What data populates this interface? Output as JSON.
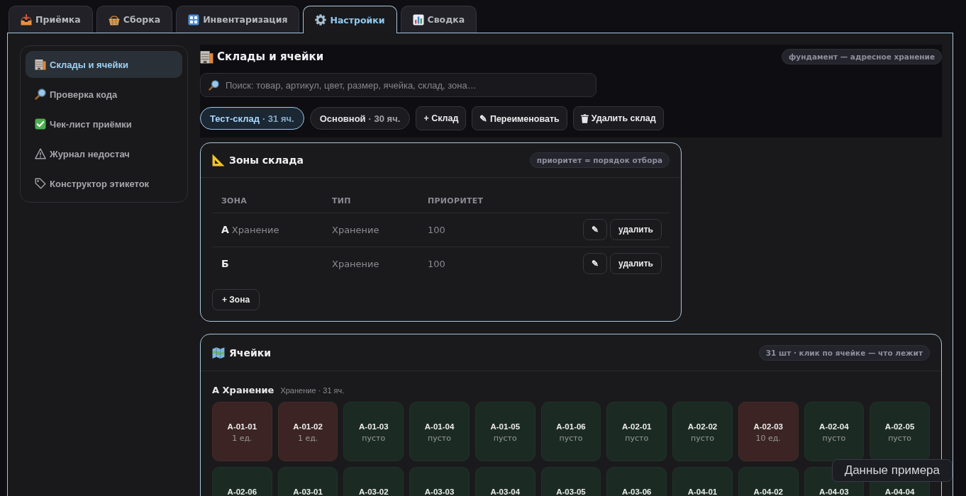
{
  "tabs": [
    {
      "label": "Приёмка",
      "selected": false
    },
    {
      "label": "Сборка",
      "selected": false
    },
    {
      "label": "Инвентаризация",
      "selected": false
    },
    {
      "label": "Настройки",
      "selected": true
    },
    {
      "label": "Сводка",
      "selected": false
    }
  ],
  "sidebar": {
    "items": [
      {
        "label": "Склады и ячейки",
        "selected": true
      },
      {
        "label": "Проверка кода",
        "selected": false
      },
      {
        "label": "Чек-лист приёмки",
        "selected": false
      },
      {
        "label": "Журнал недостач",
        "selected": false
      },
      {
        "label": "Конструктор этикеток",
        "selected": false
      }
    ]
  },
  "warehouse_panel": {
    "title": "Склады и ячейки",
    "badge": "фундамент — адресное хранение",
    "search": {
      "placeholder": "Поиск: товар, артикул, цвет, размер, ячейка, склад, зона…"
    },
    "warehouses": [
      {
        "name": "Тест-склад",
        "meta": "· 31 яч.",
        "selected": true
      },
      {
        "name": "Основной",
        "meta": "· 30 яч.",
        "selected": false
      }
    ],
    "actions": [
      {
        "label": "+ Склад",
        "kind": "text"
      },
      {
        "label": "✎ Переименовать",
        "kind": "text"
      },
      {
        "label": "Удалить склад",
        "kind": "trash"
      }
    ]
  },
  "zones": {
    "title": "Зоны склада",
    "badge": "приоритет = порядок отбора",
    "columns": [
      "ЗОНА",
      "ТИП",
      "ПРИОРИТЕТ"
    ],
    "rows": [
      {
        "zone": "А",
        "zone_note": "Хранение",
        "type": "Хранение",
        "priority": "100",
        "edit_button": "✎",
        "delete_button": "удалить"
      },
      {
        "zone": "Б",
        "type": "Хранение",
        "priority": "100",
        "edit_button": "✎",
        "delete_button": "удалить"
      }
    ],
    "add_button": "+ Зона"
  },
  "cells": {
    "title": "Ячейки",
    "badge": "31 шт · клик по ячейке — что лежит",
    "groups": [
      {
        "name": "А Хранение",
        "meta": "Хранение · 31 яч.",
        "cells": [
          {
            "code": "А-01-01",
            "contents": "1 ед.",
            "occupied": true
          },
          {
            "code": "А-01-02",
            "contents": "1 ед.",
            "occupied": true
          },
          {
            "code": "А-01-03",
            "contents": "пусто",
            "occupied": false
          },
          {
            "code": "А-01-04",
            "contents": "пусто",
            "occupied": false
          },
          {
            "code": "А-01-05",
            "contents": "пусто",
            "occupied": false
          },
          {
            "code": "А-01-06",
            "contents": "пусто",
            "occupied": false
          },
          {
            "code": "А-02-01",
            "contents": "пусто",
            "occupied": false
          },
          {
            "code": "А-02-02",
            "contents": "пусто",
            "occupied": false
          },
          {
            "code": "А-02-03",
            "contents": "10 ед.",
            "occupied": true
          },
          {
            "code": "А-02-04",
            "contents": "пусто",
            "occupied": false
          },
          {
            "code": "А-02-05",
            "contents": "пусто",
            "occupied": false
          },
          {
            "code": "А-02-06",
            "occupied": false
          },
          {
            "code": "А-03-01",
            "occupied": false
          },
          {
            "code": "А-03-02",
            "occupied": false
          },
          {
            "code": "А-03-03",
            "occupied": false
          },
          {
            "code": "А-03-04",
            "occupied": false
          },
          {
            "code": "А-03-05",
            "occupied": false
          },
          {
            "code": "А-03-06",
            "occupied": false
          },
          {
            "code": "А-04-01",
            "occupied": false
          },
          {
            "code": "А-04-02",
            "occupied": false
          },
          {
            "code": "А-04-03",
            "occupied": false
          },
          {
            "code": "А-04-04",
            "occupied": false
          }
        ]
      }
    ]
  },
  "sample_data_button": "Данные примера"
}
